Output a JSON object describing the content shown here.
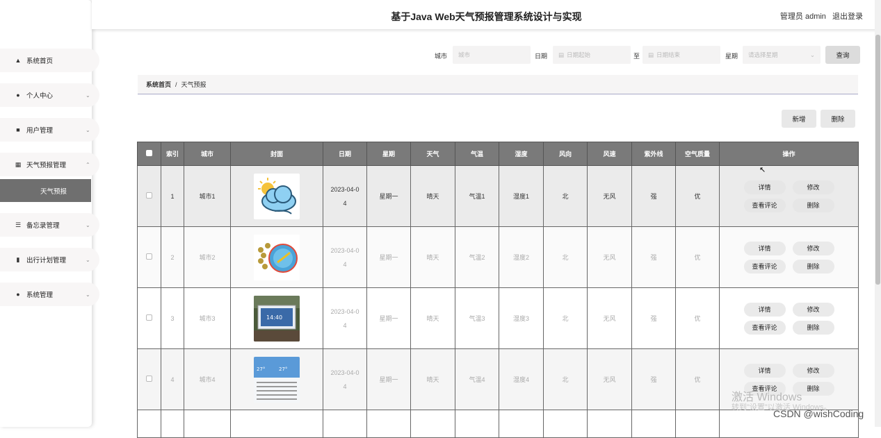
{
  "header": {
    "title": "基于Java Web天气预报管理系统设计与实现",
    "user_label": "管理员 admin",
    "logout": "退出登录"
  },
  "sidebar": {
    "items": [
      {
        "label": "系统首页",
        "icon": "home-icon"
      },
      {
        "label": "个人中心",
        "icon": "user-icon"
      },
      {
        "label": "用户管理",
        "icon": "chat-icon"
      },
      {
        "label": "天气预报管理",
        "icon": "grid-icon"
      },
      {
        "label": "备忘录管理",
        "icon": "list-icon"
      },
      {
        "label": "出行计划管理",
        "icon": "chart-icon"
      },
      {
        "label": "系统管理",
        "icon": "user-icon"
      }
    ],
    "active_sub": "天气预报"
  },
  "search": {
    "city_label": "城市",
    "city_placeholder": "城市",
    "date_label": "日期",
    "date_start": "日期起始",
    "to": "至",
    "date_end": "日期结束",
    "week_label": "星期",
    "week_placeholder": "请选择星期",
    "query": "查询"
  },
  "breadcrumb": {
    "home": "系统首页",
    "sep": "/",
    "current": "天气预报"
  },
  "actions": {
    "add": "新增",
    "delete": "删除"
  },
  "table": {
    "headers": [
      "索引",
      "城市",
      "封面",
      "日期",
      "星期",
      "天气",
      "气温",
      "湿度",
      "风向",
      "风速",
      "紫外线",
      "空气质量",
      "操作"
    ],
    "rows": [
      {
        "index": "1",
        "city": "城市1",
        "date1": "2023-04-0",
        "date2": "4",
        "week": "星期一",
        "weather": "晴天",
        "temp": "气温1",
        "humidity": "湿度1",
        "wind_dir": "北",
        "wind_speed": "无风",
        "uv": "强",
        "air": "优"
      },
      {
        "index": "2",
        "city": "城市2",
        "date1": "2023-04-0",
        "date2": "4",
        "week": "星期一",
        "weather": "晴天",
        "temp": "气温2",
        "humidity": "湿度2",
        "wind_dir": "北",
        "wind_speed": "无风",
        "uv": "强",
        "air": "优"
      },
      {
        "index": "3",
        "city": "城市3",
        "date1": "2023-04-0",
        "date2": "4",
        "week": "星期一",
        "weather": "晴天",
        "temp": "气温3",
        "humidity": "湿度3",
        "wind_dir": "北",
        "wind_speed": "无风",
        "uv": "强",
        "air": "优"
      },
      {
        "index": "4",
        "city": "城市4",
        "date1": "2023-04-0",
        "date2": "4",
        "week": "星期一",
        "weather": "晴天",
        "temp": "气温4",
        "humidity": "湿度4",
        "wind_dir": "北",
        "wind_speed": "无风",
        "uv": "强",
        "air": "优"
      }
    ],
    "ops": {
      "detail": "详情",
      "edit": "修改",
      "comments": "查看评论",
      "delete": "删除"
    }
  },
  "overlay": {
    "activate": "激活 Windows",
    "activate_sub": "转到\"设置\"以激活 Windows。",
    "csdn": "CSDN @wishCoding"
  }
}
